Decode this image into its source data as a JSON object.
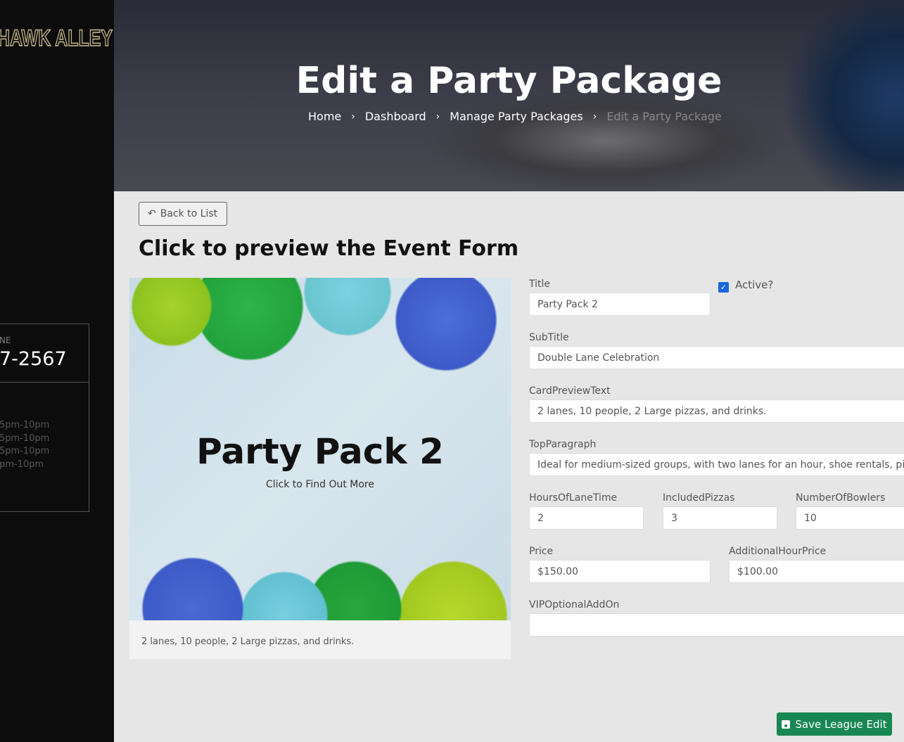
{
  "sidebar": {
    "logo": "HAWK ALLEY",
    "phone_label": "NE",
    "phone": "7-2567",
    "hours": [
      "5pm-10pm",
      "5pm-10pm",
      "5pm-10pm",
      "pm-10pm"
    ]
  },
  "hero": {
    "title": "Edit a Party Package",
    "breadcrumbs": [
      "Home",
      "Dashboard",
      "Manage Party Packages",
      "Edit a Party Package"
    ]
  },
  "back_label": "Back to List",
  "preview_heading": "Click to preview the Event Form",
  "card": {
    "title": "Party Pack 2",
    "subtitle": "Click to Find Out More",
    "text": "2 lanes, 10 people, 2 Large pizzas, and drinks."
  },
  "form": {
    "title_label": "Title",
    "title_value": "Party Pack 2",
    "active_label": "Active?",
    "active": true,
    "subtitle_label": "SubTitle",
    "subtitle_value": "Double Lane Celebration",
    "cardpreview_label": "CardPreviewText",
    "cardpreview_value": "2 lanes, 10 people, 2 Large pizzas, and drinks.",
    "topparagraph_label": "TopParagraph",
    "topparagraph_value": "Ideal for medium-sized groups, with two lanes for an hour, shoe rentals, pi",
    "hours_label": "HoursOfLaneTime",
    "hours_value": "2",
    "pizzas_label": "IncludedPizzas",
    "pizzas_value": "3",
    "bowlers_label": "NumberOfBowlers",
    "bowlers_value": "10",
    "price_label": "Price",
    "price_value": "$150.00",
    "addhour_label": "AdditionalHourPrice",
    "addhour_value": "$100.00",
    "vip_label": "VIPOptionalAddOn",
    "vip_value": ""
  },
  "save_label": "Save League Edit",
  "colors": {
    "save": "#198754",
    "checkbox": "#1a66e0"
  }
}
